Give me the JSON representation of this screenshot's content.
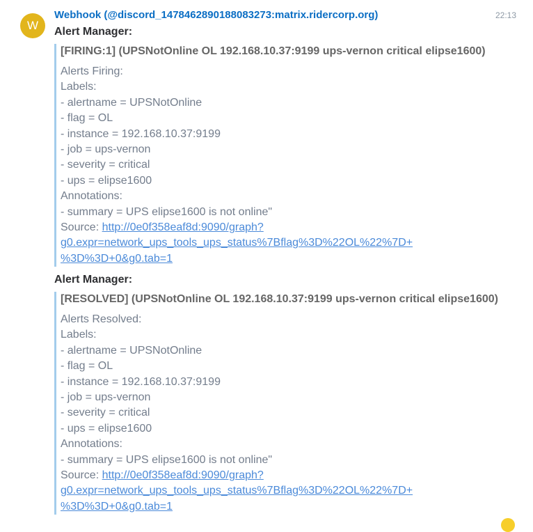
{
  "sender": {
    "avatar_letter": "W",
    "name": "Webhook (@discord_1478462890188083273:matrix.ridercorp.org)",
    "time": "22:13"
  },
  "messages": [
    {
      "title": "Alert Manager:",
      "header": "[FIRING:1] (UPSNotOnline OL 192.168.10.37:9199 ups-vernon critical elipse1600)",
      "lines": [
        "Alerts Firing:",
        "Labels:",
        "- alertname = UPSNotOnline",
        "- flag = OL",
        "- instance = 192.168.10.37:9199",
        "- job = ups-vernon",
        "- severity = critical",
        "- ups = elipse1600",
        "Annotations:",
        "- summary = UPS elipse1600 is not online\""
      ],
      "source_label": "Source: ",
      "source_link": [
        "http://0e0f358eaf8d:9090/graph?",
        "g0.expr=network_ups_tools_ups_status%7Bflag%3D%22OL%22%7D+",
        "%3D%3D+0&g0.tab=1"
      ]
    },
    {
      "title": "Alert Manager:",
      "header": "[RESOLVED] (UPSNotOnline OL 192.168.10.37:9199 ups-vernon critical elipse1600)",
      "lines": [
        "Alerts Resolved:",
        "Labels:",
        "- alertname = UPSNotOnline",
        "- flag = OL",
        "- instance = 192.168.10.37:9199",
        "- job = ups-vernon",
        "- severity = critical",
        "- ups = elipse1600",
        "Annotations:",
        "- summary = UPS elipse1600 is not online\""
      ],
      "source_label": "Source: ",
      "source_link": [
        "http://0e0f358eaf8d:9090/graph?",
        "g0.expr=network_ups_tools_ups_status%7Bflag%3D%22OL%22%7D+",
        "%3D%3D+0&g0.tab=1"
      ]
    }
  ],
  "colors": {
    "sender": "#0b6ec4",
    "avatar": "#e2b51c",
    "quote_border": "#a3ccec",
    "link": "#4b8ad9"
  }
}
